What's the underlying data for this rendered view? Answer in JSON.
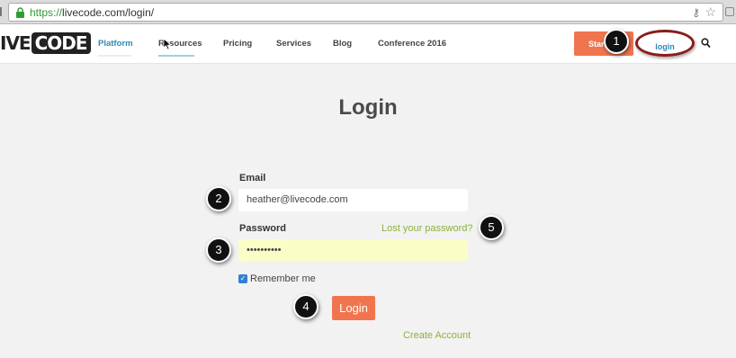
{
  "browser": {
    "url_scheme": "https://",
    "url_rest": "livecode.com/login/"
  },
  "header": {
    "logo_part1": "IVE",
    "logo_part2": "CODE",
    "nav": [
      {
        "label": "Platform"
      },
      {
        "label": "Resources"
      },
      {
        "label": "Pricing"
      },
      {
        "label": "Services"
      },
      {
        "label": "Blog"
      },
      {
        "label": "Conference 2016"
      }
    ],
    "start_label": "Start",
    "login_label": "login"
  },
  "colors": {
    "accent_orange": "#f0754f",
    "link_blue": "#2a8ab8",
    "link_green": "#8ab33a",
    "annotation_red": "#8a1c1c"
  },
  "form": {
    "title": "Login",
    "email_label": "Email",
    "email_value": "heather@livecode.com",
    "password_label": "Password",
    "password_value": "••••••••••",
    "lost_password": "Lost your password?",
    "remember_label": "Remember me",
    "remember_checked": true,
    "login_button": "Login",
    "create_account": "Create Account"
  },
  "badges": [
    "1",
    "2",
    "3",
    "4",
    "5"
  ]
}
